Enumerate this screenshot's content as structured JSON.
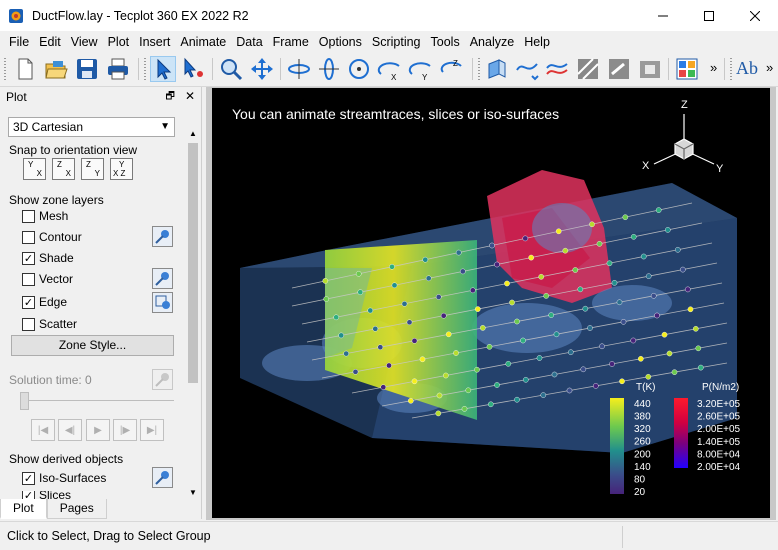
{
  "window": {
    "title": "DuctFlow.lay - Tecplot 360 EX 2022 R2",
    "minimize_glyph": "—",
    "maximize_glyph": "☐",
    "close_glyph": "✕"
  },
  "menu": [
    "File",
    "Edit",
    "View",
    "Plot",
    "Insert",
    "Animate",
    "Data",
    "Frame",
    "Options",
    "Scripting",
    "Tools",
    "Analyze",
    "Help"
  ],
  "toolbar": {
    "overflow_glyph": "»",
    "text_tool_label": "Ab",
    "icons": [
      "new-icon",
      "open-icon",
      "save-icon",
      "print-icon",
      "select-icon",
      "adjustor-icon",
      "zoom-icon",
      "translate-icon",
      "rotate-x-icon",
      "rotate-y-icon",
      "spherical-rotate-icon",
      "rotate-xaxis-icon",
      "rotate-yaxis-icon",
      "rotate-zaxis-icon",
      "slice-icon",
      "streamtrace-icon",
      "streamtrace-rake-icon",
      "contour-tool-icon",
      "probe-icon",
      "zone-icon",
      "color-map-icon"
    ]
  },
  "panel": {
    "title": "Plot",
    "float_glyph": "🗗",
    "close_glyph": "✕",
    "plot_type": "3D Cartesian",
    "snap_label": "Snap to orientation view",
    "snap_buttons": [
      {
        "top": "Y",
        "bottom": "X"
      },
      {
        "top": "Z",
        "bottom": "X"
      },
      {
        "top": "Z",
        "bottom": "Y"
      },
      {
        "top": "Y",
        "bottom": "X Z"
      }
    ],
    "zone_layers_label": "Show zone layers",
    "layers": [
      {
        "label": "Mesh",
        "checked": false
      },
      {
        "label": "Contour",
        "checked": false
      },
      {
        "label": "Shade",
        "checked": true
      },
      {
        "label": "Vector",
        "checked": false
      },
      {
        "label": "Edge",
        "checked": true
      },
      {
        "label": "Scatter",
        "checked": false
      }
    ],
    "zone_style_button": "Zone Style...",
    "solution_time_label": "Solution time:",
    "solution_time_value": "0",
    "derived_label": "Show derived objects",
    "derived": [
      {
        "label": "Iso-Surfaces",
        "checked": true
      },
      {
        "label": "Slices",
        "checked": true
      }
    ],
    "tabs": [
      "Plot",
      "Pages"
    ],
    "player_glyphs": [
      "|◀",
      "◀|",
      "▶",
      "|▶",
      "▶|"
    ]
  },
  "viewport": {
    "caption": "You can animate streamtraces, slices or iso-surfaces",
    "axes": {
      "x": "X",
      "y": "Y",
      "z": "Z"
    },
    "legend_t": {
      "title": "T(K)",
      "labels": [
        "440",
        "380",
        "320",
        "260",
        "200",
        "140",
        "80",
        "20"
      ],
      "colors": [
        "#f6ee1c",
        "#b7dc2e",
        "#6cc94f",
        "#2fae7f",
        "#218f8c",
        "#2c6f8e",
        "#3a4d8a",
        "#46237a"
      ]
    },
    "legend_p": {
      "title": "P(N/m2)",
      "labels": [
        "3.20E+05",
        "2.60E+05",
        "2.00E+05",
        "1.40E+05",
        "8.00E+04",
        "2.00E+04"
      ],
      "colors": [
        "#ff1a2c",
        "#e4002a",
        "#b4005a",
        "#7a007f",
        "#4a00b8",
        "#2200ff"
      ]
    }
  },
  "status": {
    "text": "Click to Select, Drag to Select Group"
  }
}
